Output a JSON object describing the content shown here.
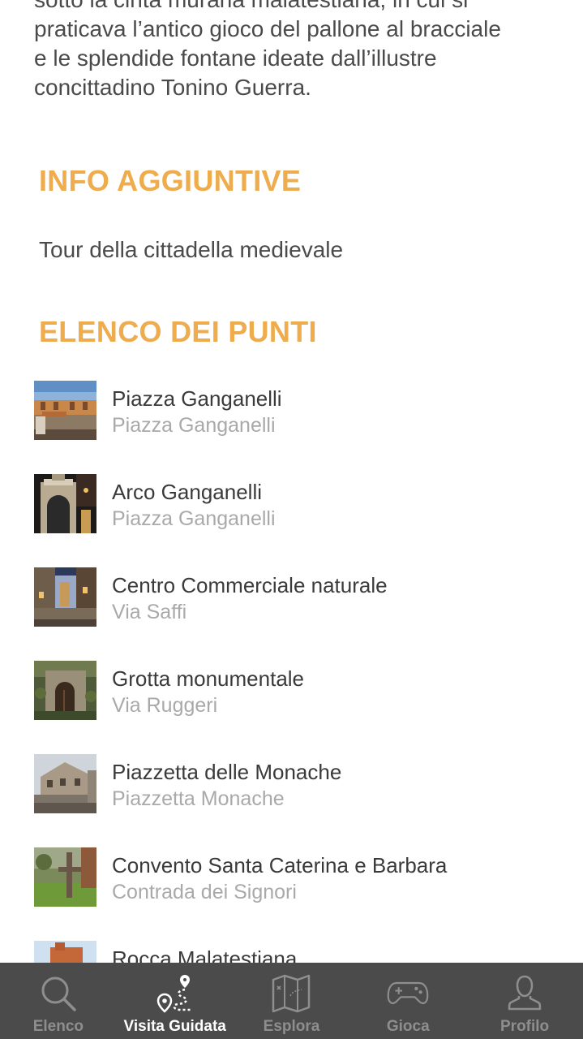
{
  "intro": {
    "lines": [
      "sotto la cinta muraria malatestiana, in cui si",
      "praticava l’antico gioco del pallone al bracciale",
      "e le splendide fontane ideate dall’illustre",
      "concittadino Tonino Guerra."
    ]
  },
  "info": {
    "title": "INFO AGGIUNTIVE",
    "text": "Tour della cittadella medievale"
  },
  "points": {
    "title": "ELENCO DEI PUNTI",
    "items": [
      {
        "name": "Piazza Ganganelli",
        "address": "Piazza Ganganelli",
        "thumb": "piazza-photo"
      },
      {
        "name": "Arco Ganganelli",
        "address": "Piazza Ganganelli",
        "thumb": "arch-photo"
      },
      {
        "name": "Centro Commerciale naturale",
        "address": "Via Saffi",
        "thumb": "street-photo"
      },
      {
        "name": "Grotta monumentale",
        "address": "Via Ruggeri",
        "thumb": "grotto-photo"
      },
      {
        "name": "Piazzetta delle Monache",
        "address": "Piazzetta Monache",
        "thumb": "square-photo"
      },
      {
        "name": "Convento Santa Caterina e Barbara",
        "address": "Contrada dei Signori",
        "thumb": "convent-photo"
      },
      {
        "name": "Rocca Malatestiana",
        "address": "",
        "thumb": "fortress-photo"
      }
    ]
  },
  "tabbar": {
    "tabs": [
      {
        "label": "Elenco",
        "icon": "search-icon",
        "active": false
      },
      {
        "label": "Visita Guidata",
        "icon": "route-icon",
        "active": true
      },
      {
        "label": "Esplora",
        "icon": "map-icon",
        "active": false
      },
      {
        "label": "Gioca",
        "icon": "gamepad-icon",
        "active": false
      },
      {
        "label": "Profilo",
        "icon": "user-icon",
        "active": false
      }
    ]
  },
  "colors": {
    "accent": "#eeac4c",
    "tabbar_bg": "#4b4b4b",
    "tab_inactive": "#8e8e8e",
    "tab_active": "#ffffff"
  }
}
